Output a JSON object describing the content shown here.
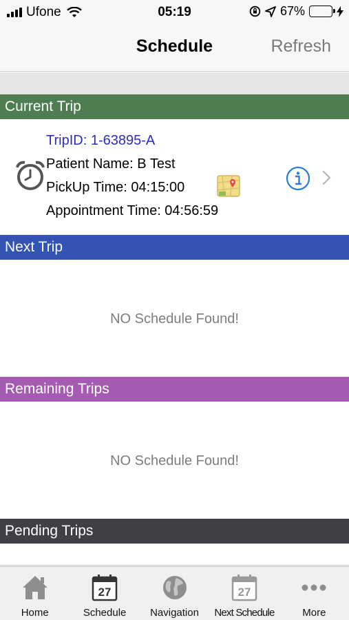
{
  "status_bar": {
    "carrier": "Ufone",
    "time": "05:19",
    "battery_percent": "67%",
    "battery_level": 0.67
  },
  "nav": {
    "title": "Schedule",
    "refresh_label": "Refresh"
  },
  "sections": {
    "current": {
      "title": "Current Trip",
      "color": "#4e7d51"
    },
    "next": {
      "title": "Next Trip",
      "color": "#3454b4",
      "empty_message": "NO Schedule Found!"
    },
    "remaining": {
      "title": "Remaining Trips",
      "color": "#a45bb1",
      "empty_message": "NO Schedule Found!"
    },
    "pending": {
      "title": "Pending Trips",
      "color": "#3f4046"
    }
  },
  "current_trip": {
    "trip_id": "TripID: 1-63895-A",
    "patient": "Patient Name: B Test",
    "pickup": "PickUp Time: 04:15:00",
    "appointment": "Appointment Time: 04:56:59"
  },
  "tabs": [
    {
      "label": "Home",
      "icon": "home-icon"
    },
    {
      "label": "Schedule",
      "icon": "calendar-icon",
      "day": "27"
    },
    {
      "label": "Navigation",
      "icon": "globe-icon"
    },
    {
      "label": "Next Schedule",
      "icon": "calendar-icon",
      "day": "27"
    },
    {
      "label": "More",
      "icon": "more-dots-icon"
    }
  ]
}
